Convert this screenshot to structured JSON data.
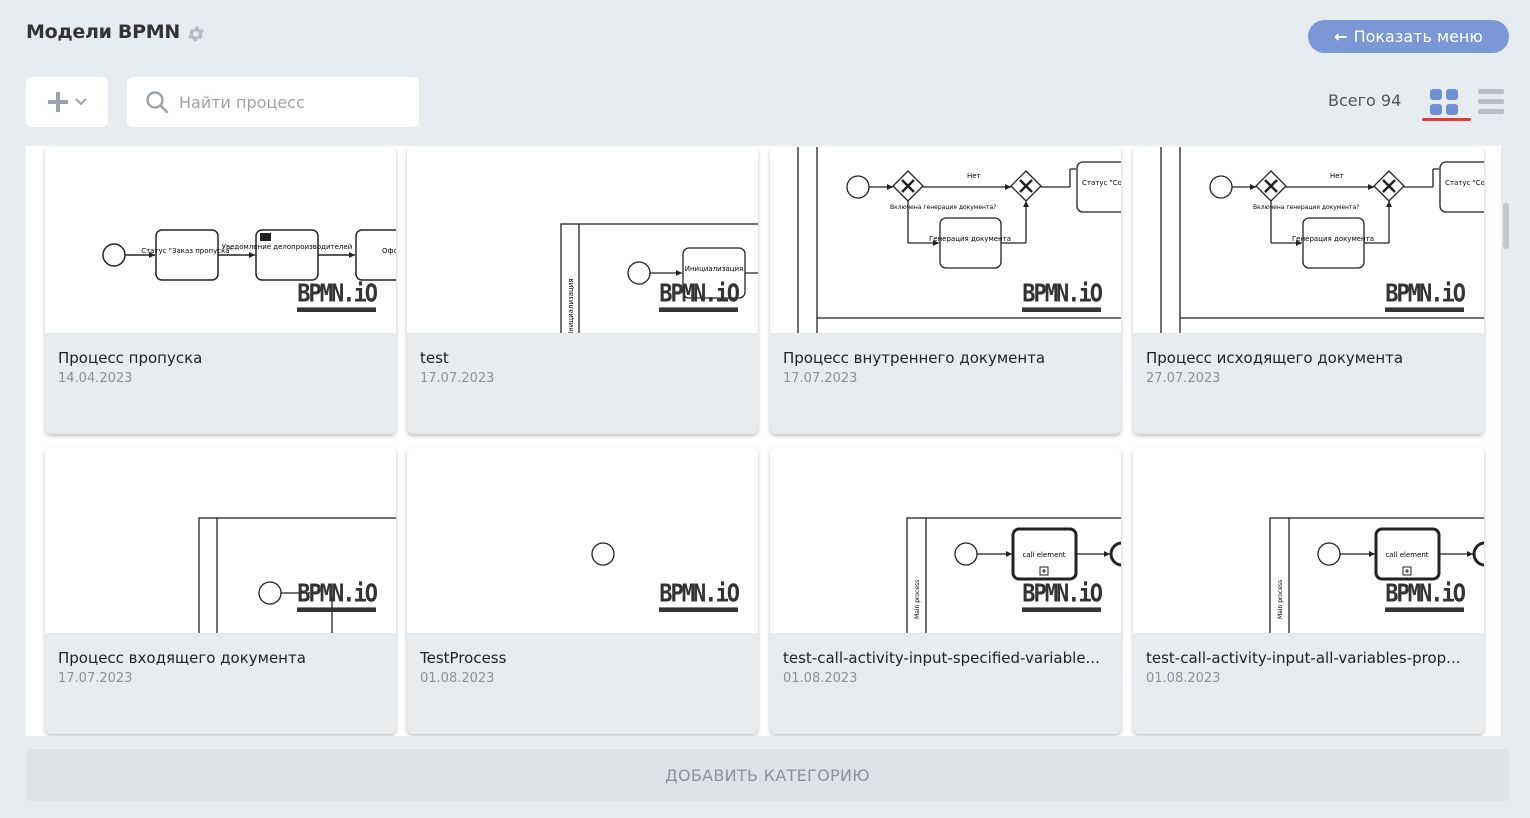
{
  "header": {
    "title": "Модели BPMN",
    "settings_icon": "gear-icon",
    "show_menu_label": "Показать меню"
  },
  "toolbar": {
    "add_icon": "plus-icon",
    "search_placeholder": "Найти процесс",
    "total_label": "Всего 94",
    "active_view": "grid"
  },
  "watermark": "BPMN.iO",
  "diagram_text": {
    "status_order": "Статус \"Заказ пропуска\"",
    "notify": "Уведомление делопроизводителей",
    "oform": "Оформл...",
    "init": "Инициализация",
    "init_lane": "Инициализация",
    "no": "Нет",
    "gen_enabled": "Включена генерация документа?",
    "gen_doc": "Генерация документа",
    "status_agree": "Статус \"Согласова...",
    "call_element": "call element",
    "main_process": "Main process"
  },
  "cards": [
    {
      "name": "Процесс пропуска",
      "date": "14.04.2023"
    },
    {
      "name": "test",
      "date": "17.07.2023"
    },
    {
      "name": "Процесс внутреннего документа",
      "date": "17.07.2023"
    },
    {
      "name": "Процесс исходящего документа",
      "date": "27.07.2023"
    },
    {
      "name": "Процесс входящего документа",
      "date": "17.07.2023"
    },
    {
      "name": "TestProcess",
      "date": "01.08.2023"
    },
    {
      "name": "test-call-activity-input-specified-variable...",
      "date": "01.08.2023"
    },
    {
      "name": "test-call-activity-input-all-variables-prop...",
      "date": "01.08.2023"
    }
  ],
  "footer": {
    "add_category_label": "ДОБАВИТЬ КАТЕГОРИЮ"
  }
}
